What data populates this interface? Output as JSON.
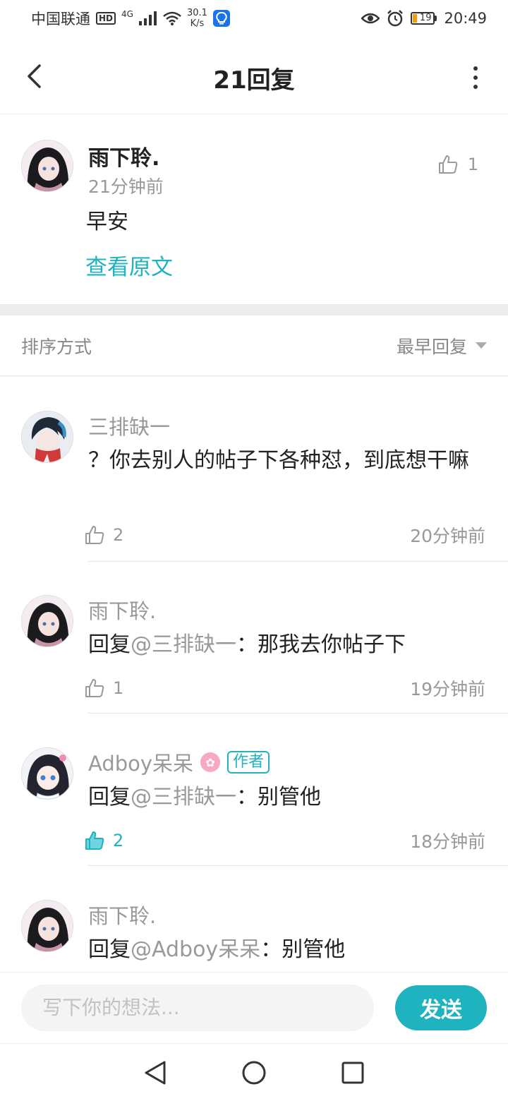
{
  "status_bar": {
    "carrier": "中国联通",
    "hd": "HD",
    "network": "4G",
    "speed_value": "30.1",
    "speed_unit": "K/s",
    "battery": "19",
    "time": "20:49"
  },
  "header": {
    "title": "21回复"
  },
  "original_post": {
    "author": "雨下聆.",
    "time": "21分钟前",
    "text": "早安",
    "view_original": "查看原文",
    "likes": "1"
  },
  "sort": {
    "label": "排序方式",
    "selected": "最早回复"
  },
  "comments": [
    {
      "author": "三排缺一",
      "text": "？你去别人的帖子下各种怼，到底想干嘛",
      "likes": "2",
      "time": "20分钟前"
    },
    {
      "author": "雨下聆.",
      "reply_prefix": "回复",
      "reply_to": "@三排缺一",
      "text": "：那我去你帖子下",
      "likes": "1",
      "time": "19分钟前"
    },
    {
      "author": "Adboy呆呆",
      "author_tag": "作者",
      "reply_prefix": "回复",
      "reply_to": "@三排缺一",
      "text": "：别管他",
      "likes": "2",
      "time": "18分钟前",
      "liked": true
    },
    {
      "author": "雨下聆.",
      "reply_prefix": "回复",
      "reply_to": "@Adboy呆呆",
      "text": "：别管他"
    }
  ],
  "input": {
    "placeholder": "写下你的想法...",
    "send_label": "发送"
  },
  "colors": {
    "accent": "#1fb2bf",
    "muted_text": "#999999",
    "battery_low": "#f39c12"
  }
}
